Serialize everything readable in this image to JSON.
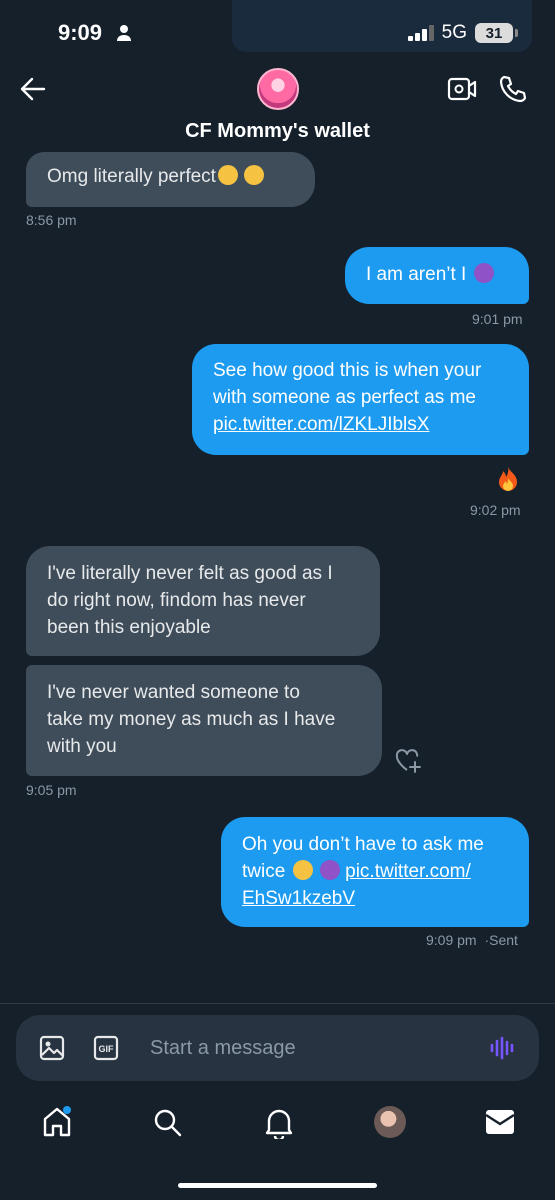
{
  "status_bar": {
    "time": "9:09",
    "network": "5G",
    "battery": "31"
  },
  "header": {
    "title": "CF Mommy's wallet"
  },
  "messages": [
    {
      "id": "m1",
      "direction": "in",
      "text": "Omg literally perfect",
      "emoji": [
        "dizzy-face-emoji",
        "dizzy-face-emoji"
      ],
      "time": "8:56 pm"
    },
    {
      "id": "m2",
      "direction": "out",
      "text": "I am aren’t I",
      "emoji": [
        "smiling-devil-emoji"
      ],
      "time": "9:01 pm"
    },
    {
      "id": "m3",
      "direction": "out",
      "line1": "See how good this is when your",
      "line2": "with someone as perfect as me",
      "link": "pic.twitter.com/lZKLJIblsX",
      "reaction": "fire-emoji",
      "time": "9:02 pm"
    },
    {
      "id": "m4",
      "direction": "in",
      "line1": "I've literally never felt as good as I",
      "line2": "do right now, findom has never",
      "line3": "been this enjoyable"
    },
    {
      "id": "m5",
      "direction": "in",
      "line1": "I've never wanted someone to",
      "line2": "take my money as much as I have",
      "line3": "with you",
      "time": "9:05 pm"
    },
    {
      "id": "m6",
      "direction": "out",
      "line1": "Oh you don’t have to ask me",
      "line2_prefix": "twice",
      "link_part1": "pic.twitter.com/",
      "link_part2": "EhSw1kzebV",
      "time": "9:09 pm",
      "status": "·Sent"
    }
  ],
  "composer": {
    "placeholder": "Start a message"
  },
  "icons": [
    "back-arrow-icon",
    "video-call-icon",
    "phone-icon",
    "image-icon",
    "gif-icon",
    "voice-icon",
    "home-icon",
    "search-icon",
    "bell-icon",
    "mail-icon",
    "add-reaction-icon"
  ],
  "colors": {
    "background": "#15202b",
    "outgoing_bubble": "#1d9bf0",
    "incoming_bubble": "#3f4d5b",
    "accent_voice": "#7856ff"
  }
}
